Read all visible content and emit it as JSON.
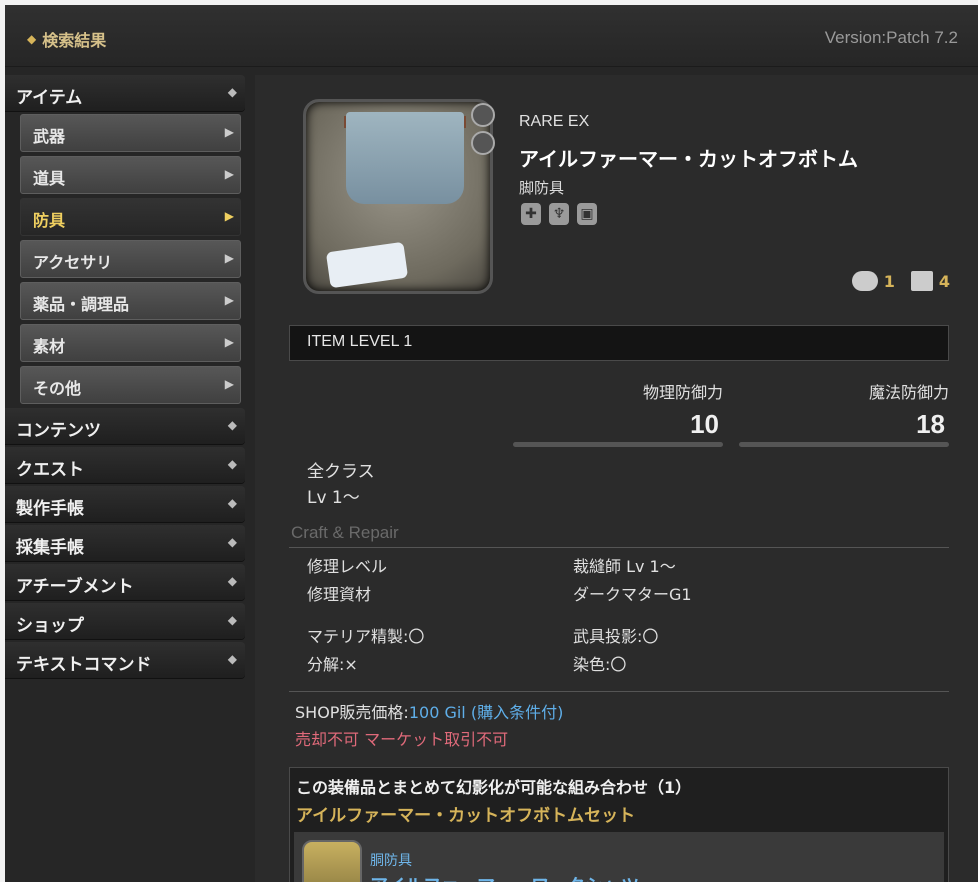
{
  "header": {
    "title": "検索結果",
    "version": "Version:Patch 7.2"
  },
  "sidebar": {
    "categories": [
      {
        "label": "アイテム"
      },
      {
        "label": "コンテンツ"
      },
      {
        "label": "クエスト"
      },
      {
        "label": "製作手帳"
      },
      {
        "label": "採集手帳"
      },
      {
        "label": "アチーブメント"
      },
      {
        "label": "ショップ"
      },
      {
        "label": "テキストコマンド"
      }
    ],
    "item_subs": [
      {
        "label": "武器"
      },
      {
        "label": "道具"
      },
      {
        "label": "防具"
      },
      {
        "label": "アクセサリ"
      },
      {
        "label": "薬品・調理品"
      },
      {
        "label": "素材"
      },
      {
        "label": "その他"
      }
    ],
    "active_sub": "防具"
  },
  "item": {
    "rarity": "RARE EX",
    "name": "アイルファーマー・カットオフボトム",
    "category": "脚防具",
    "comments": "1",
    "shares": "4",
    "item_level": "ITEM LEVEL 1",
    "phys_def_label": "物理防御力",
    "phys_def": "10",
    "mag_def_label": "魔法防御力",
    "mag_def": "18",
    "classes": "全クラス",
    "level": "Lv 1〜"
  },
  "craft": {
    "heading": "Craft & Repair",
    "repair_level_label": "修理レベル",
    "repair_level_value": "裁縫師 Lv 1〜",
    "repair_mat_label": "修理資材",
    "repair_mat_value": "ダークマターG1",
    "materia": "マテリア精製:〇",
    "glamour": "武具投影:〇",
    "desynth": "分解:×",
    "dye": "染色:〇"
  },
  "shop": {
    "label": "SHOP販売価格:",
    "price": "100 Gil (購入条件付)",
    "restrictions": "売却不可 マーケット取引不可"
  },
  "set": {
    "heading": "この装備品とまとめて幻影化が可能な組み合わせ（1）",
    "name": "アイルファーマー・カットオフボトムセット",
    "item_category": "胴防具",
    "item_name": "アイルファーマー・ワークシャツ"
  }
}
